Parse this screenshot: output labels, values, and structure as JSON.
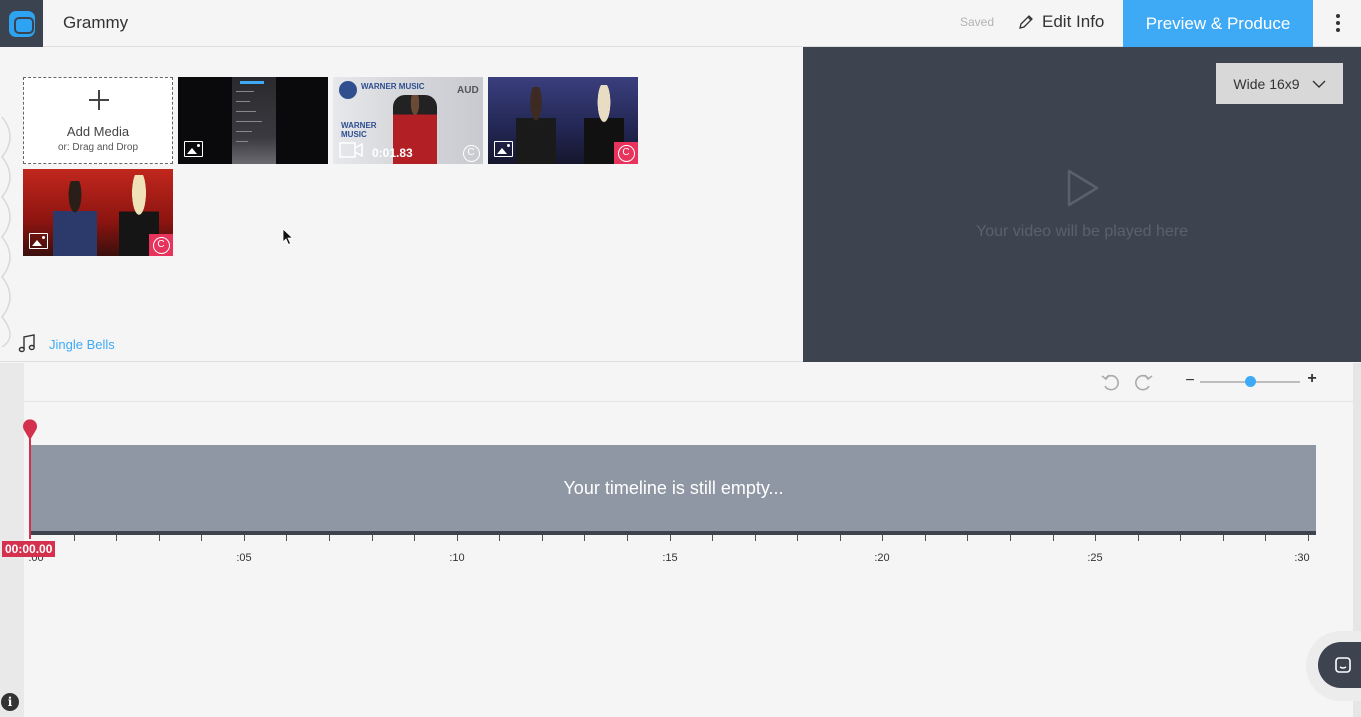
{
  "header": {
    "project_title": "Grammy",
    "saved_status": "Saved",
    "edit_info_label": "Edit Info",
    "preview_button_label": "Preview & Produce"
  },
  "media": {
    "add_media_label": "Add Media",
    "add_media_sub": "or: Drag and Drop",
    "items": [
      {
        "type": "image",
        "copyright_badge": false
      },
      {
        "type": "video",
        "duration": "0:01.83",
        "copyright_badge": false
      },
      {
        "type": "image",
        "copyright_badge": true
      },
      {
        "type": "image",
        "copyright_badge": true
      }
    ],
    "thumb2_text": {
      "top": "WARNER MUSIC",
      "bottom": "WARNER MUSIC",
      "right": "AUD"
    },
    "music_track": "Jingle Bells",
    "copyright_symbol": "C"
  },
  "player": {
    "aspect_label": "Wide 16x9",
    "message": "Your video will be played here"
  },
  "timeline": {
    "empty_message": "Your timeline is still empty...",
    "current_time": "00:00.00",
    "tick_labels": [
      ":00",
      ":05",
      ":10",
      ":15",
      ":20",
      ":25",
      ":30"
    ],
    "zoom_minus": "−",
    "zoom_plus": "+",
    "zoom_level": 0.5
  },
  "footer": {
    "info_label": "i"
  },
  "colors": {
    "accent": "#3eaaf5",
    "playhead": "#d4314f",
    "player_bg": "#3d4450",
    "copyright_badge": "#e8335d"
  }
}
